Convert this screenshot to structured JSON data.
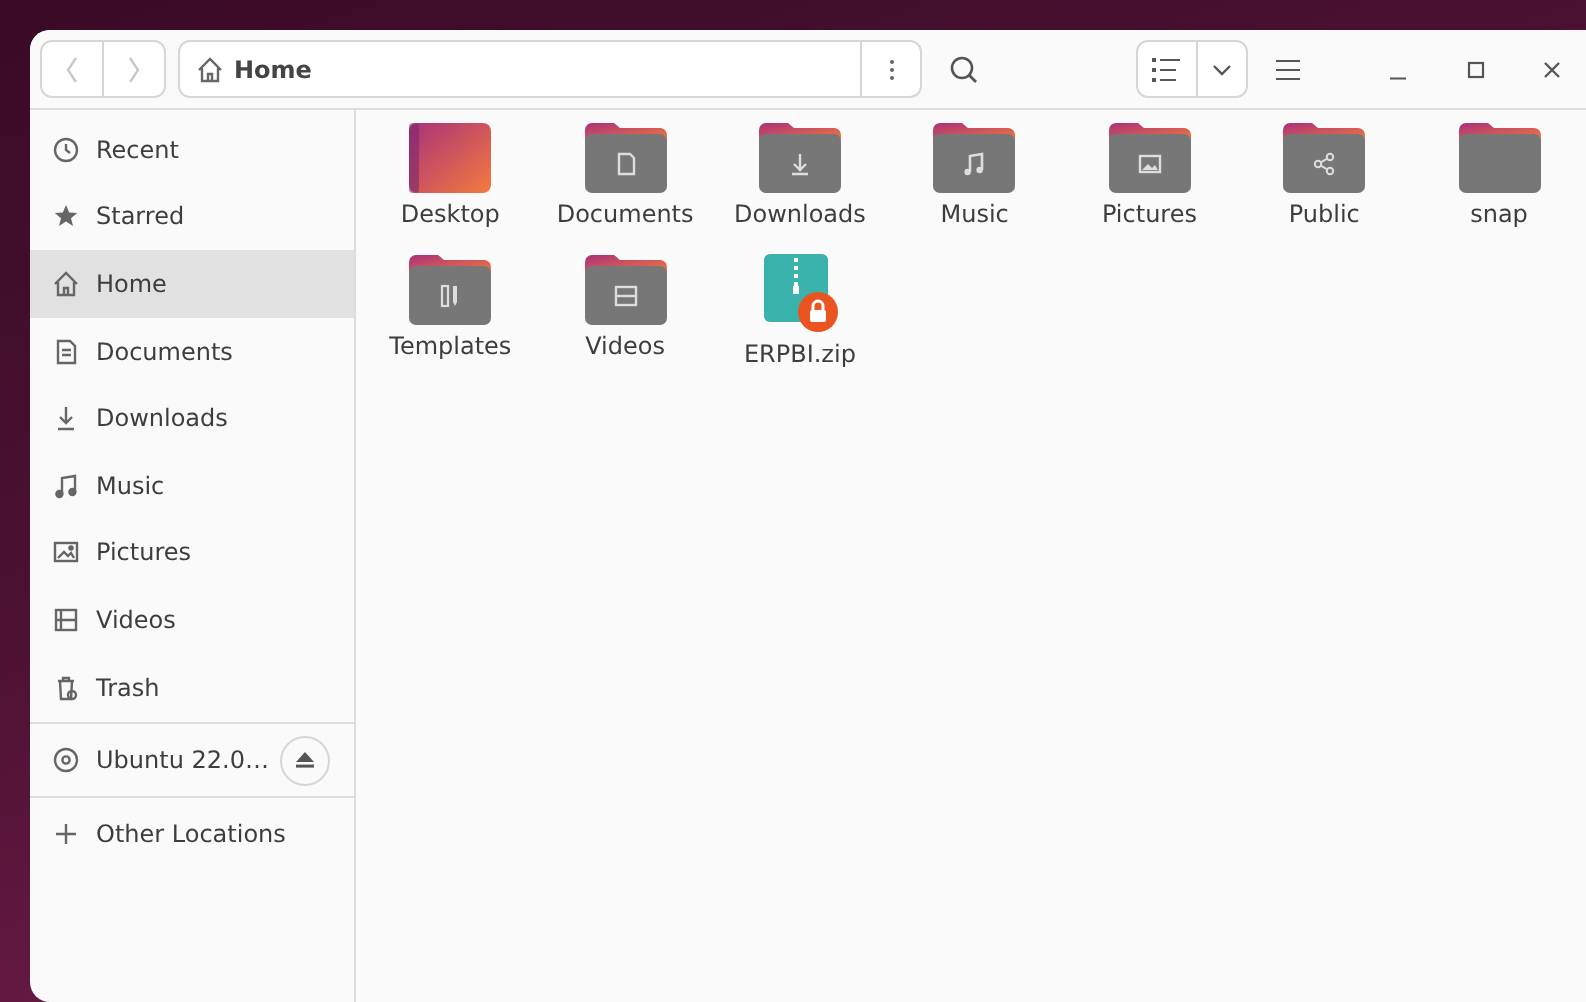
{
  "header": {
    "location": "Home",
    "back_disabled": true,
    "forward_disabled": true
  },
  "sidebar": {
    "places": [
      {
        "label": "Recent",
        "kind": "recent",
        "selected": false
      },
      {
        "label": "Starred",
        "kind": "starred",
        "selected": false
      },
      {
        "label": "Home",
        "kind": "home",
        "selected": true
      },
      {
        "label": "Documents",
        "kind": "documents",
        "selected": false
      },
      {
        "label": "Downloads",
        "kind": "downloads",
        "selected": false
      },
      {
        "label": "Music",
        "kind": "music",
        "selected": false
      },
      {
        "label": "Pictures",
        "kind": "pictures",
        "selected": false
      },
      {
        "label": "Videos",
        "kind": "videos",
        "selected": false
      },
      {
        "label": "Trash",
        "kind": "trash",
        "selected": false
      }
    ],
    "devices": [
      {
        "label": "Ubuntu 22.0…",
        "kind": "disc",
        "selected": false
      }
    ],
    "other": [
      {
        "label": "Other Locations",
        "kind": "plus",
        "selected": false
      }
    ]
  },
  "files": [
    {
      "name": "Desktop",
      "kind": "desktop"
    },
    {
      "name": "Documents",
      "kind": "documents"
    },
    {
      "name": "Downloads",
      "kind": "downloads"
    },
    {
      "name": "Music",
      "kind": "music"
    },
    {
      "name": "Pictures",
      "kind": "pictures"
    },
    {
      "name": "Public",
      "kind": "public"
    },
    {
      "name": "snap",
      "kind": "plain"
    },
    {
      "name": "Templates",
      "kind": "templates"
    },
    {
      "name": "Videos",
      "kind": "videos"
    },
    {
      "name": "ERPBI.zip",
      "kind": "archive"
    }
  ]
}
